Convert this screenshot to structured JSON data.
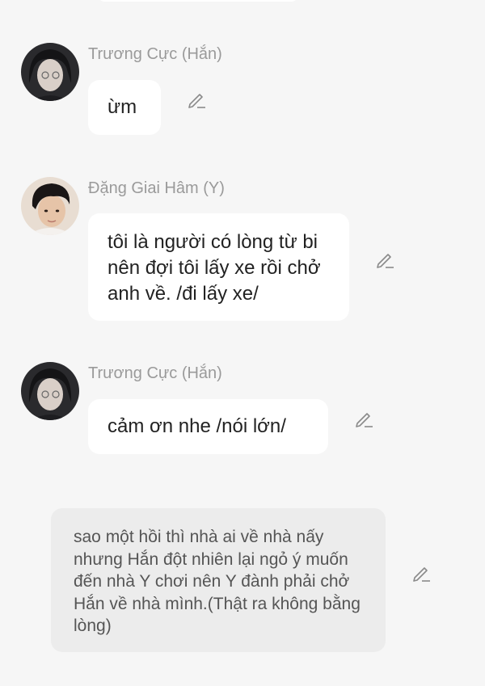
{
  "messages": [
    {
      "sender": "Trương Cực (Hắn)",
      "text": "ừm",
      "avatar": "avatar-truong-cuc"
    },
    {
      "sender": "Đặng Giai Hâm (Y)",
      "text": "tôi là người có lòng từ bi nên đợi tôi lấy xe rồi chở anh về. /đi lấy xe/",
      "avatar": "avatar-dang-giai-ham"
    },
    {
      "sender": "Trương Cực (Hắn)",
      "text": "cảm ơn nhe /nói lớn/",
      "avatar": "avatar-truong-cuc"
    }
  ],
  "narration": {
    "text": "sao một hồi thì nhà ai về nhà nấy nhưng Hắn đột nhiên lại ngỏ ý muốn đến nhà Y chơi nên Y đành phải chở Hắn về nhà mình.(Thật ra không bằng lòng)"
  },
  "icons": {
    "edit": "pencil-edit-icon"
  },
  "colors": {
    "background": "#f6f6f6",
    "bubble": "#ffffff",
    "narration_bubble": "#ececec",
    "sender_text": "#9a9a9a",
    "icon": "#8a8a8a"
  }
}
